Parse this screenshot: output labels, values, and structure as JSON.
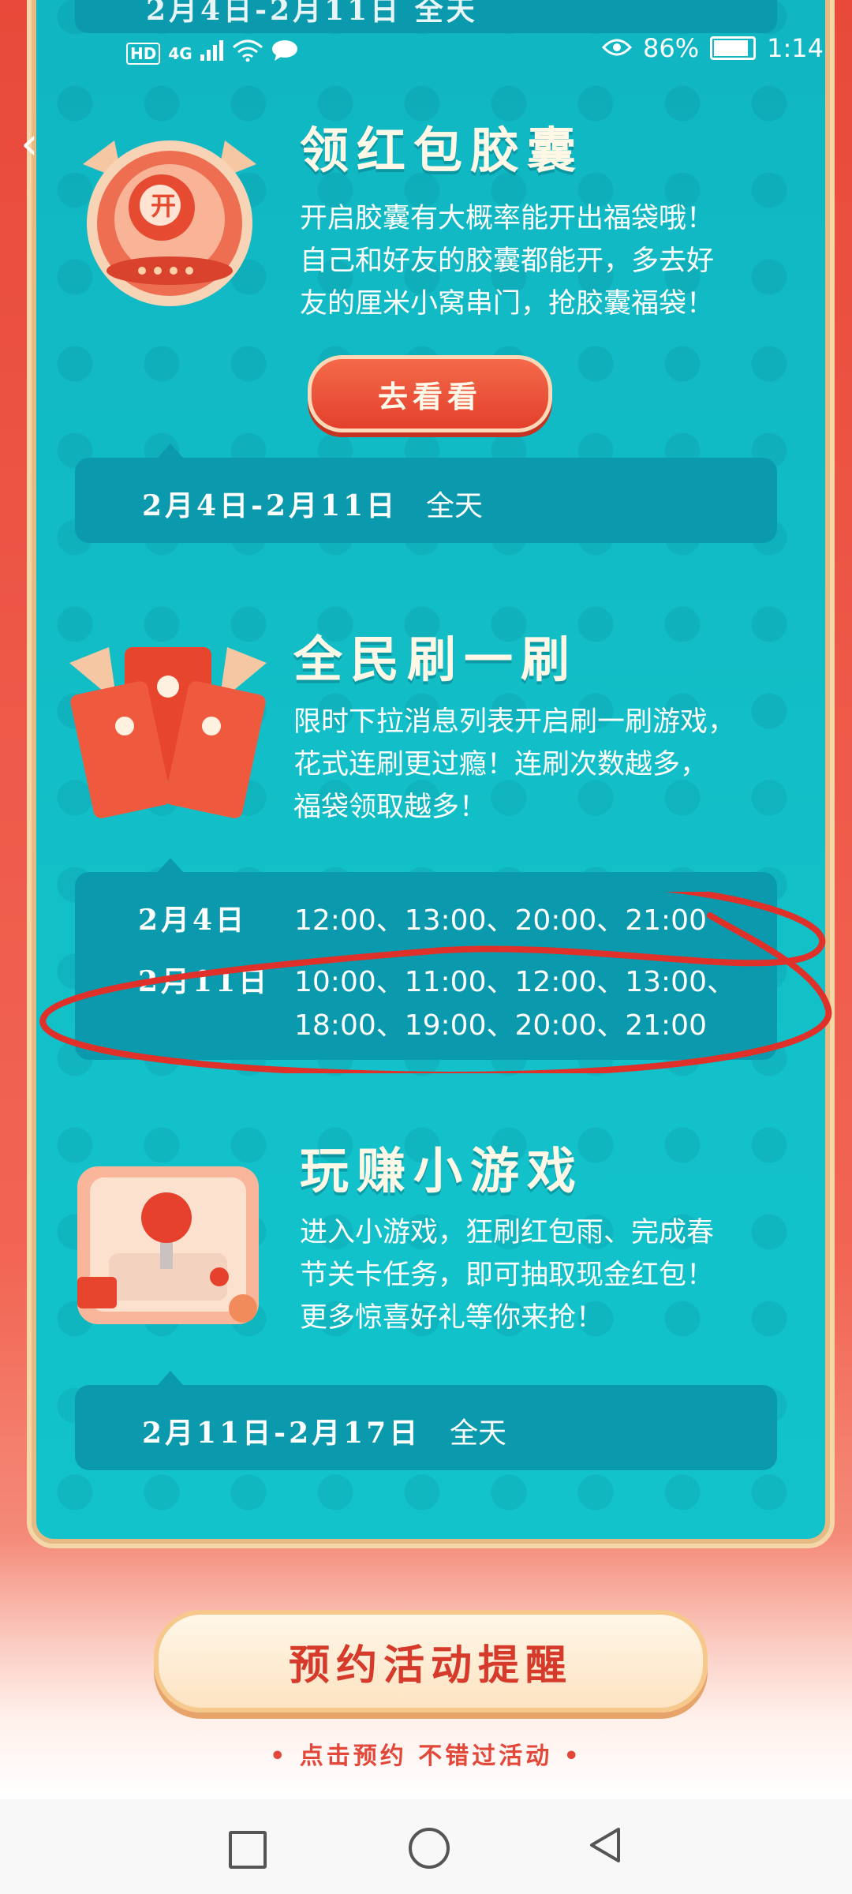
{
  "status_bar": {
    "left_indicators": [
      "HD",
      "4G",
      "signal-icon",
      "wifi-icon",
      "message-icon"
    ],
    "battery_percent": "86%",
    "time": "1:14"
  },
  "top_partial_text": "2月4日-2月11日  全天",
  "sections": [
    {
      "title": "领红包胶囊",
      "description": [
        "开启胶囊有大概率能开出福袋哦！",
        "自己和好友的胶囊都能开，多去好",
        "友的厘米小窝串门，抢胶囊福袋！"
      ],
      "button": "去看看",
      "date_range": "2月4日-2月11日",
      "time_range": "全天",
      "icon_badge": "开"
    },
    {
      "title": "全民刷一刷",
      "description": [
        "限时下拉消息列表开启刷一刷游戏，",
        "花式连刷更过瘾！连刷次数越多，",
        "福袋领取越多！"
      ],
      "schedule": [
        {
          "date": "2月4日",
          "times": [
            "12:00、13:00、20:00、21:00"
          ]
        },
        {
          "date": "2月11日",
          "times": [
            "10:00、11:00、12:00、13:00、",
            "18:00、19:00、20:00、21:00"
          ]
        }
      ]
    },
    {
      "title": "玩赚小游戏",
      "description": [
        "进入小游戏，狂刷红包雨、完成春",
        "节关卡任务，即可抽取现金红包！",
        "更多惊喜好礼等你来抢！"
      ],
      "date_range": "2月11日-2月17日",
      "time_range": "全天"
    }
  ],
  "reserve_button": "预约活动提醒",
  "reserve_subtext": "• 点击预约  不错过活动 •",
  "colors": {
    "teal_panel": "#12c0c8",
    "info_box": "#0b9aad",
    "red_bg": "#ef5a48",
    "annotation_red": "#e0302a"
  }
}
